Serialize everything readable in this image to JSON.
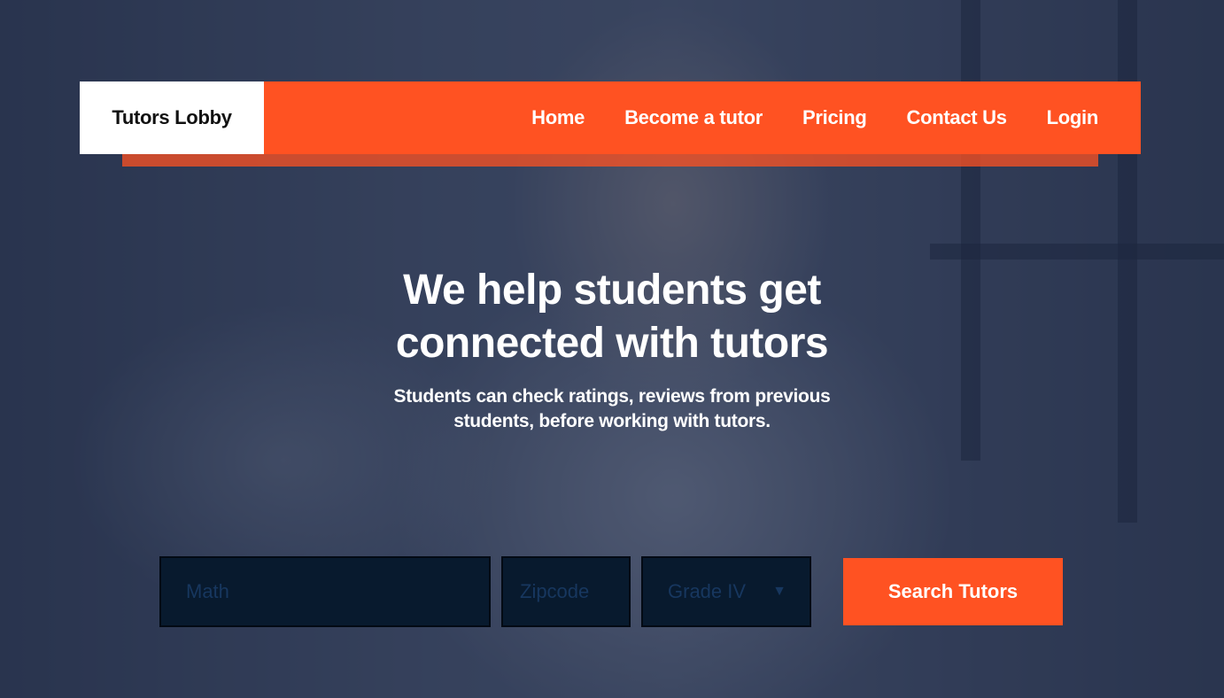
{
  "header": {
    "brand": "Tutors Lobby",
    "nav": [
      "Home",
      "Become a tutor",
      "Pricing",
      "Contact Us",
      "Login"
    ]
  },
  "hero": {
    "title_line1": "We help students get",
    "title_line2": "connected with tutors",
    "subtitle_line1": "Students can check ratings, reviews from previous",
    "subtitle_line2": "students, before working with tutors."
  },
  "search": {
    "subject_placeholder": "Math",
    "zip_placeholder": "Zipcode",
    "grade_selected": "Grade IV",
    "button_label": "Search Tutors"
  },
  "colors": {
    "accent": "#ff5222",
    "field_bg": "#081a2e",
    "field_text": "#17375f"
  },
  "icons": {
    "grade_caret": "chevron-down-icon"
  }
}
